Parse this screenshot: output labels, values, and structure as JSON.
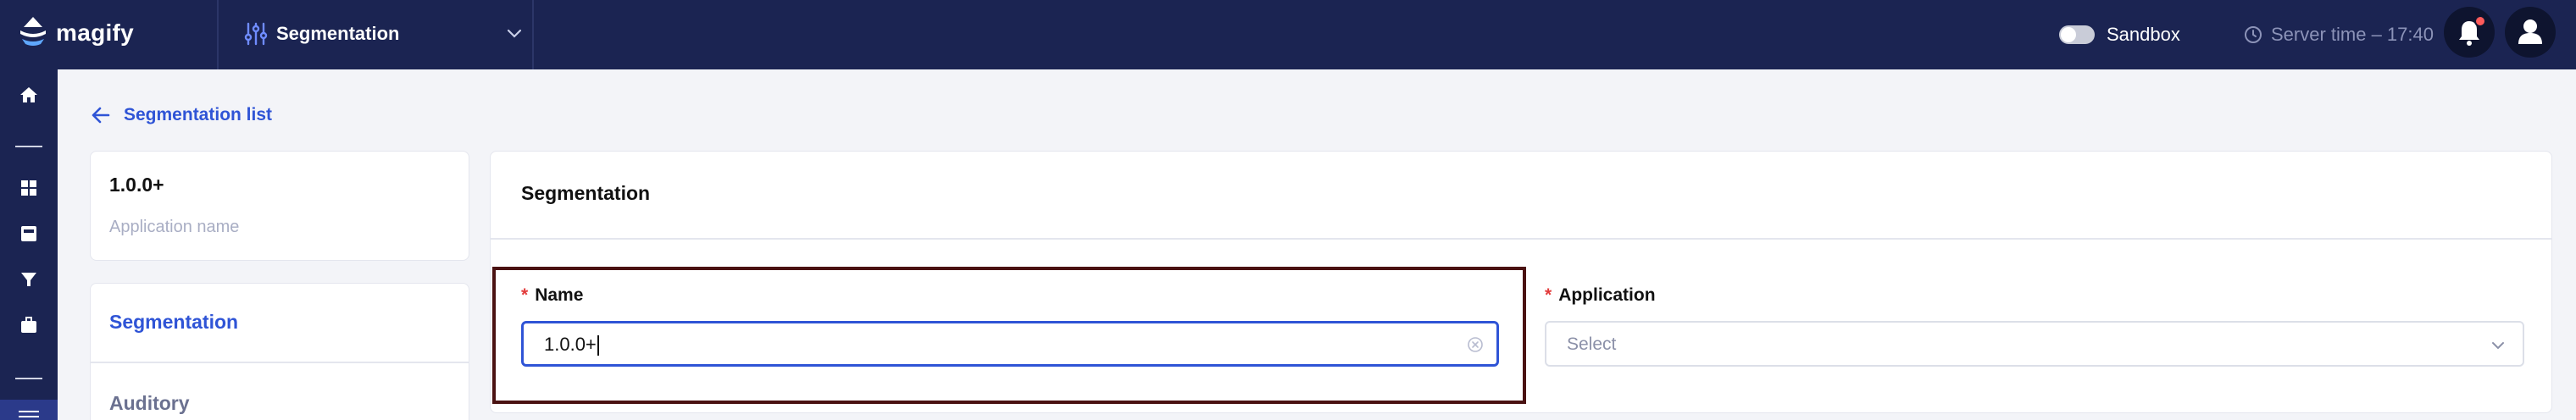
{
  "app": {
    "brand": "magify"
  },
  "context_selector": {
    "label": "Segmentation"
  },
  "header": {
    "sandbox_label": "Sandbox",
    "sandbox_enabled": false,
    "server_time": "Server time – 17:40",
    "notifications_unread": true
  },
  "back_link": {
    "label": "Segmentation list"
  },
  "info_card": {
    "title": "1.0.0+",
    "subtitle": "Application name"
  },
  "nav": {
    "items": [
      {
        "label": "Segmentation",
        "active": true
      },
      {
        "label": "Auditory",
        "active": false
      }
    ]
  },
  "form": {
    "title": "Segmentation",
    "name": {
      "label": "Name",
      "required": true,
      "value": "1.0.0+"
    },
    "application": {
      "label": "Application",
      "required": true,
      "placeholder": "Select"
    }
  },
  "colors": {
    "topbar": "#1b2452",
    "accent": "#2f54d6",
    "required": "#e23b3b",
    "highlight_border": "#4a1212"
  },
  "icons": {
    "rail": [
      "home-icon",
      "dash-separator",
      "grid-icon",
      "inbox-icon",
      "filter-icon",
      "briefcase-icon",
      "dash-separator",
      "sliders-icon"
    ]
  }
}
